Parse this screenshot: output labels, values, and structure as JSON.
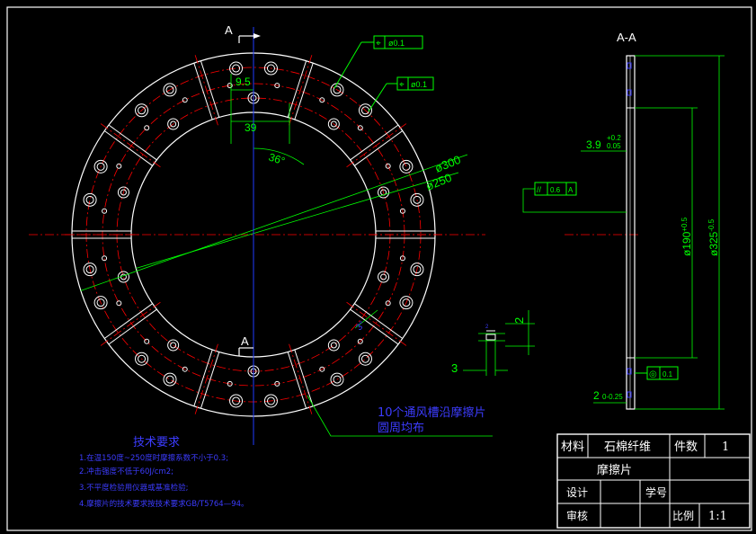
{
  "colors": {
    "background": "#000000",
    "outline": "#ffffff",
    "center_line": "#ff0000",
    "dimension": "#00ff00",
    "note_text": "#3c3cff",
    "axis_blue": "#1f3cff"
  },
  "view_labels": {
    "section_top": "A",
    "section_bottom": "A",
    "section_view": "A-A"
  },
  "dimensions": {
    "d_9_5": "9.5",
    "d_39": "39",
    "angle_36": "36°",
    "dia_300": "ø300",
    "dia_250": "ø250",
    "angle_3": "3°",
    "groove_width_3": "3",
    "groove_depth_2": "2",
    "thickness": "3.9",
    "thickness_tol_upper": "+0.2",
    "thickness_tol_lower": "0.05",
    "dia_190": "ø190",
    "dia_190_tol": "+0.5",
    "dia_325": "ø325",
    "dia_325_tol": "-0.5",
    "chamfer": "2",
    "chamfer_tol": "0-0.25"
  },
  "tolerance_frames": [
    {
      "symbol": "⌖",
      "value": "ø0.1"
    },
    {
      "symbol": "⌖",
      "value": "ø0.1"
    },
    {
      "symbol": "//",
      "value": "0.6",
      "datum": "A"
    },
    {
      "symbol": "◎",
      "value": "0.1"
    }
  ],
  "annotation": {
    "slot_line1": "10个通风槽沿摩擦片",
    "slot_line2": "圆周均布"
  },
  "tech_requirements": {
    "title": "技术要求",
    "items": [
      "1.在温150度~250度时摩擦系数不小于0.3;",
      "2.冲击强度不低于60J/cm2;",
      "3.不平度检验用仪器或基准检验;",
      "4.摩擦片的技术要求按技术要求GB/T5764—94。"
    ]
  },
  "title_block": {
    "material_label": "材料",
    "material_value": "石棉纤维",
    "qty_label": "件数",
    "qty_value": "1",
    "part_name": "摩擦片",
    "design_label": "设计",
    "student_no_label": "学号",
    "review_label": "审核",
    "scale_label": "比例",
    "scale_value": "1:1"
  }
}
